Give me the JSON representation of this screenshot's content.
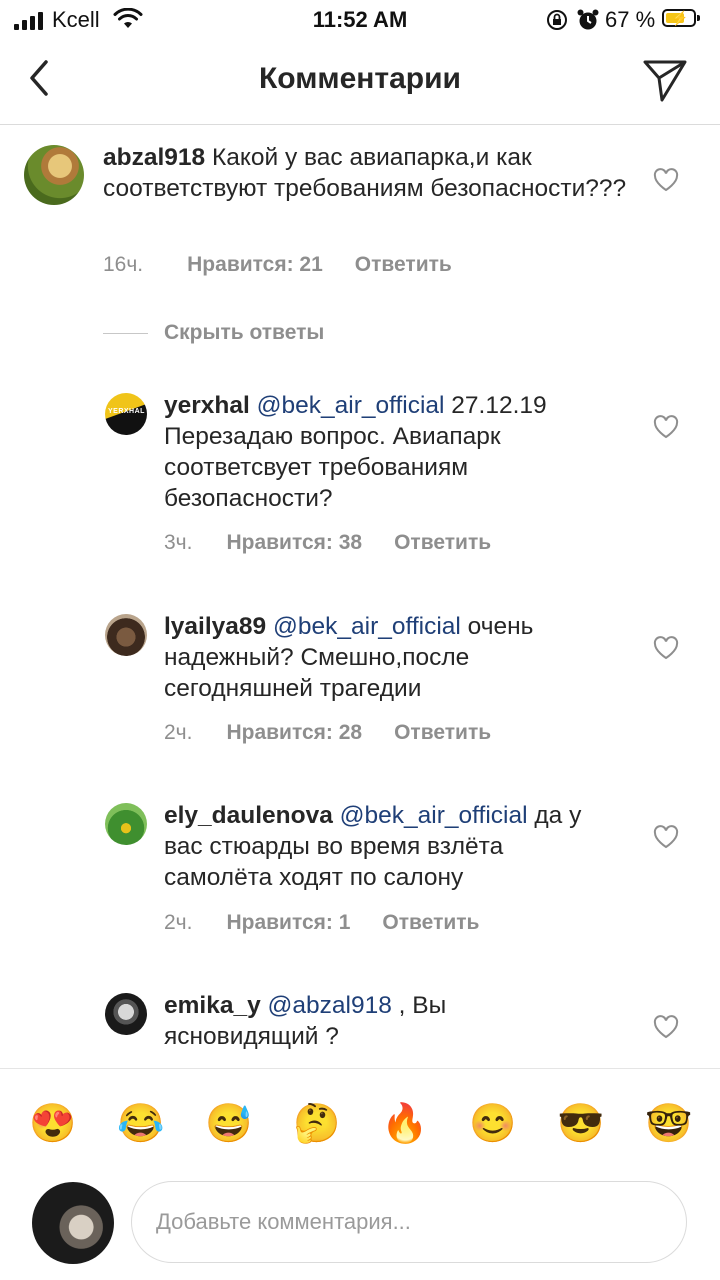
{
  "status_bar": {
    "carrier": "Kcell",
    "time": "11:52 AM",
    "battery_percent": "67 %"
  },
  "header": {
    "title": "Комментарии"
  },
  "main_comment": {
    "username": "abzal918",
    "text": "Какой у вас авиапарка,и как соответствуют требованиям безопасности???",
    "time": "16ч.",
    "likes": "Нравится: 21",
    "reply": "Ответить"
  },
  "hide_replies": "Скрыть ответы",
  "replies": [
    {
      "username": "yerxhal",
      "mention": "@bek_air_official",
      "text_line1_after": " 27.12.19",
      "text_rest": "Перезадаю вопрос. Авиапарк соответсвует требованиям безопасности?",
      "avatar_label": "YERXHAL",
      "time": "3ч.",
      "likes": "Нравится: 38",
      "reply": "Ответить"
    },
    {
      "username": "lyailya89",
      "mention": "@bek_air_official",
      "text_line1_after": " очень",
      "text_rest": "надежный? Смешно,после сегодняшней трагедии",
      "time": "2ч.",
      "likes": "Нравится: 28",
      "reply": "Ответить"
    },
    {
      "username": "ely_daulenova",
      "mention": "@bek_air_official",
      "text_line1_after": " да",
      "text_rest": "у вас стюарды во время взлёта самолёта ходят по салону",
      "time": "2ч.",
      "likes": "Нравится: 1",
      "reply": "Ответить"
    },
    {
      "username": "emika_y",
      "mention": "@abzal918",
      "text_line1_after": " , Вы",
      "text_rest": "ясновидящий ?"
    }
  ],
  "emoji_bar": [
    "😍",
    "😂",
    "😅",
    "🤔",
    "🔥",
    "😊",
    "😎",
    "🤓"
  ],
  "input": {
    "placeholder": "Добавьте комментария..."
  },
  "colors": {
    "mention": "#1f3f77",
    "meta_gray": "#8e8e8e",
    "divider": "#dbdbdb"
  }
}
